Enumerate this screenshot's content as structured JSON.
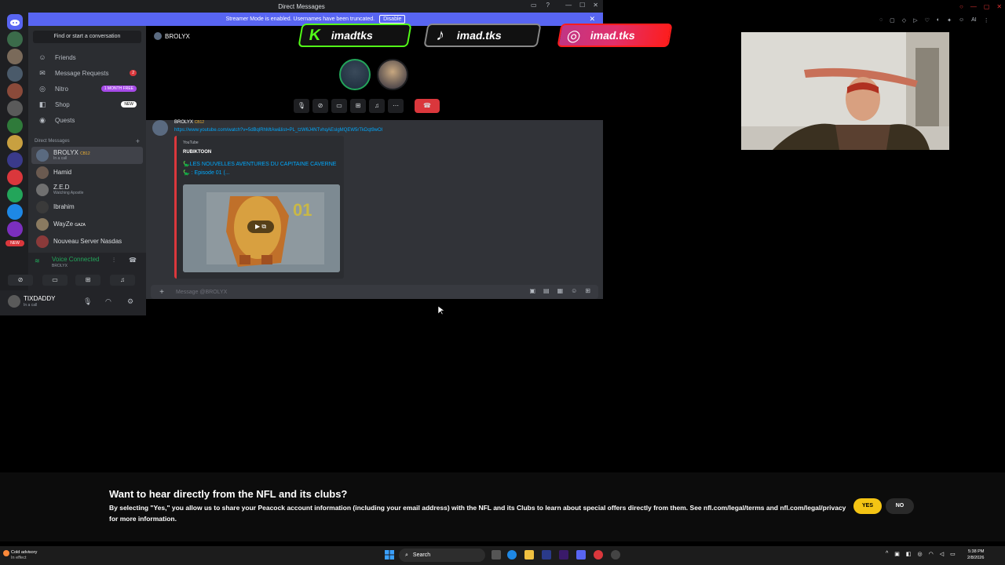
{
  "discord": {
    "window_title": "Direct Messages",
    "streamer_banner": {
      "text": "Streamer Mode is enabled. Usernames have been truncated.",
      "button": "Disable"
    },
    "search_placeholder": "Find or start a conversation",
    "nav": [
      {
        "label": "Friends",
        "icon": "friends-icon"
      },
      {
        "label": "Message Requests",
        "badge": "2"
      },
      {
        "label": "Nitro",
        "badge": "1 MONTH FREE"
      },
      {
        "label": "Shop",
        "badge": "NEW"
      },
      {
        "label": "Quests"
      }
    ],
    "dm_header": "Direct Messages",
    "dms": [
      {
        "name": "BROLYX",
        "tag": "CB12",
        "sub": "In a call",
        "active": true
      },
      {
        "name": "Hamid",
        "sub": ""
      },
      {
        "name": "Z.E.D",
        "sub": "Watching Apostle"
      },
      {
        "name": "Ibrahim",
        "sub": ""
      },
      {
        "name": "WayZe",
        "tag": "GAZA",
        "sub": ""
      },
      {
        "name": "Nouveau Server Nasdas",
        "sub": ""
      }
    ],
    "server_badge": "NEW",
    "voice": {
      "status": "Voice Connected",
      "sub": "BROLYX"
    },
    "user": {
      "name": "TIXDADDY",
      "sub": "In a call"
    },
    "call": {
      "name": "BROLYX"
    },
    "message": {
      "author": "BROLYX",
      "tag": "CB12",
      "link": "https://www.youtube.com/watch?v=5dBqlRhMtAw&list=PL_tzW6J4NTvhqAEslgMQEW5rTkDqt9wOl",
      "embed": {
        "provider": "YouTube",
        "author": "RUBIKTOON",
        "title": "🦕LES NOUVELLES AVENTURES DU CAPITAINE CAVERNE🦕 : Episode 01 (...",
        "thumb_number": "01"
      }
    },
    "input_placeholder": "Message @BROLYX"
  },
  "socials": [
    {
      "platform": "kick",
      "handle": "imadtks",
      "color": "#53fc18"
    },
    {
      "platform": "tiktok",
      "handle": "imad.tks",
      "color": "#ffffff"
    },
    {
      "platform": "instagram",
      "handle": "imad.tks",
      "color": "#e1306c"
    }
  ],
  "nfl": {
    "title": "Want to hear directly from the NFL and its clubs?",
    "body": "By selecting \"Yes,\" you allow us to share your Peacock account information (including your email address) with the NFL and its Clubs to learn about special offers directly from them. See nfl.com/legal/terms and nfl.com/legal/privacy for more information.",
    "yes": "YES",
    "no": "NO",
    "accent": "#f4c414"
  },
  "taskbar": {
    "weather_line1": "Cold advisory",
    "weather_line2": "In effect",
    "search": "Search",
    "time": "5:38 PM",
    "date": "2/8/2026"
  }
}
